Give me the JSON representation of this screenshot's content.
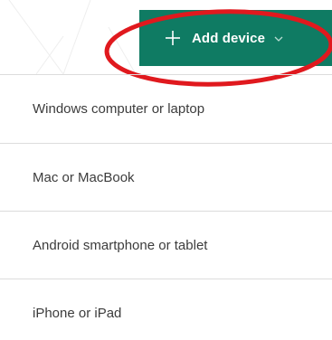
{
  "header": {
    "add_device_label": "Add device",
    "button_color": "#0f7b63",
    "annotation_color": "#e0191e"
  },
  "icons": {
    "add": "plus-icon",
    "expand": "chevron-down-icon"
  },
  "menu": {
    "items": [
      {
        "label": "Windows computer or laptop"
      },
      {
        "label": "Mac or MacBook"
      },
      {
        "label": "Android smartphone or tablet"
      },
      {
        "label": "iPhone or iPad"
      }
    ]
  }
}
